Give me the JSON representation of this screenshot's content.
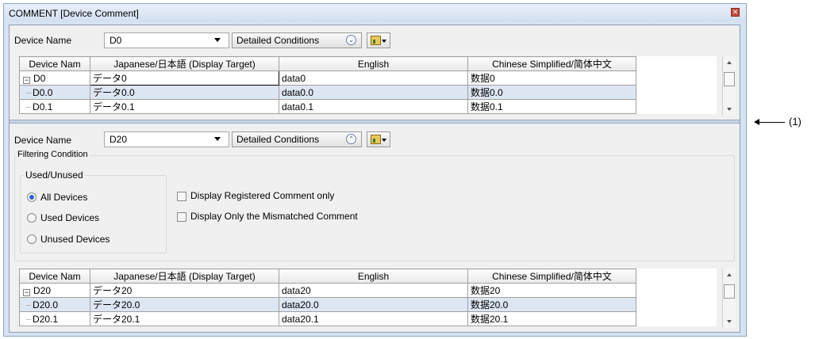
{
  "window": {
    "title": "COMMENT [Device Comment]",
    "close_glyph": "✕"
  },
  "top": {
    "device_name_label": "Device Name",
    "device_value": "D0",
    "detailed_label": "Detailed Conditions",
    "detailed_glyph": "⌄"
  },
  "grid_headers": [
    "Device Nam",
    "Japanese/日本語 (Display Target)",
    "English",
    "Chinese Simplified/简体中文"
  ],
  "top_rows": [
    {
      "device": "D0",
      "jp": "データ0",
      "en": "data0",
      "zh": "数据0"
    },
    {
      "device": "D0.0",
      "jp": "データ0.0",
      "en": "data0.0",
      "zh": "数据0.0"
    },
    {
      "device": "D0.1",
      "jp": "データ0.1",
      "en": "data0.1",
      "zh": "数据0.1"
    }
  ],
  "bottom": {
    "device_name_label": "Device Name",
    "device_value": "D20",
    "detailed_label": "Detailed Conditions",
    "detailed_glyph": "⌃",
    "filtering_label": "Filtering Condition",
    "used_unused_label": "Used/Unused",
    "radios": [
      "All Devices",
      "Used Devices",
      "Unused Devices"
    ],
    "selected_radio": "All Devices",
    "checkboxes": [
      "Display Registered Comment only",
      "Display Only the Mismatched Comment"
    ]
  },
  "bottom_rows": [
    {
      "device": "D20",
      "jp": "データ20",
      "en": "data20",
      "zh": "数据20"
    },
    {
      "device": "D20.0",
      "jp": "データ20.0",
      "en": "data20.0",
      "zh": "数据20.0"
    },
    {
      "device": "D20.1",
      "jp": "データ20.1",
      "en": "data20.1",
      "zh": "数据20.1"
    }
  ],
  "annotation": "(1)"
}
